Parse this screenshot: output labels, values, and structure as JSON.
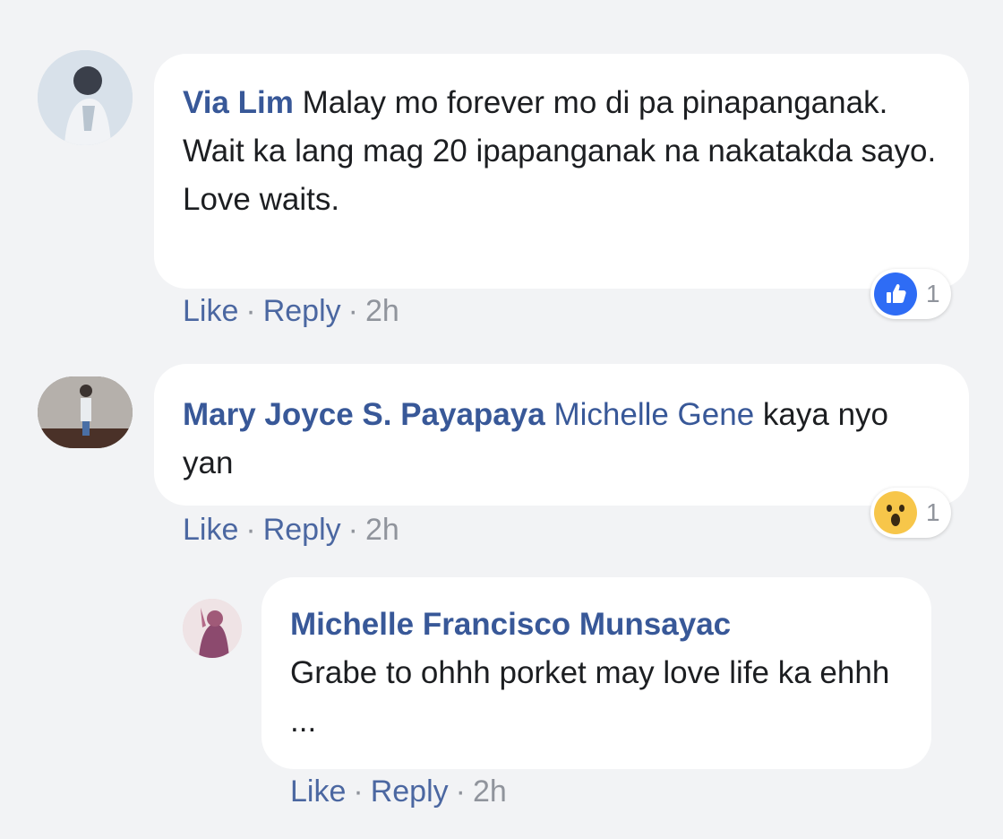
{
  "comments": [
    {
      "author": "Via Lim",
      "text": "Malay mo forever mo di pa pinapanganak. Wait ka lang mag 20 ipapanganak na nakatakda sayo. Love waits.",
      "like_label": "Like",
      "reply_label": "Reply",
      "time": "2h",
      "reaction_icon": "like-icon",
      "reaction_count": "1",
      "reaction_color": "#2e6cf5"
    },
    {
      "author": "Mary Joyce S. Payapaya",
      "mention": "Michelle Gene",
      "text": "kaya nyo yan",
      "like_label": "Like",
      "reply_label": "Reply",
      "time": "2h",
      "reaction_icon": "wow-icon",
      "reaction_count": "1",
      "reaction_color": "#f7c64a"
    }
  ],
  "reply": {
    "author": "Michelle Francisco Munsayac",
    "text": "Grabe to ohhh porket may love life ka ehhh ...",
    "like_label": "Like",
    "reply_label": "Reply",
    "time": "2h"
  },
  "separator": "·"
}
